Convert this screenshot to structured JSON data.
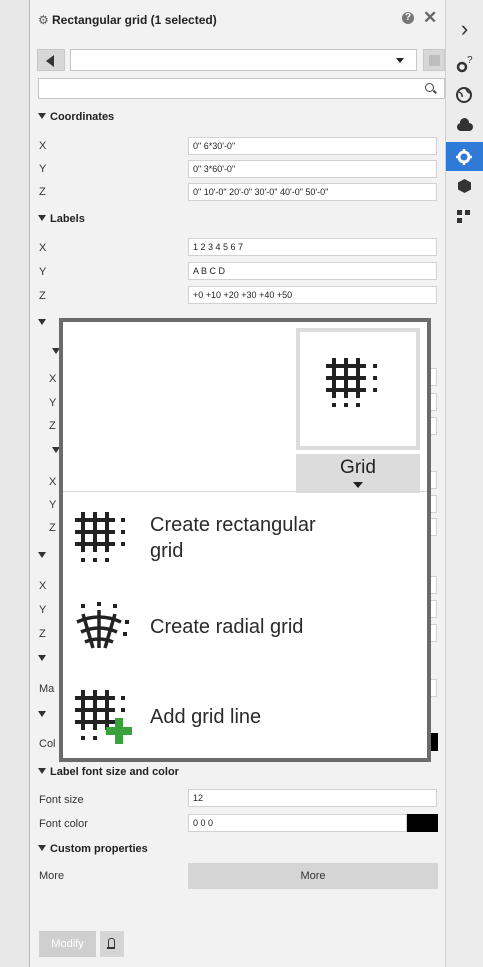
{
  "panel": {
    "title": "Rectangular grid (1 selected)",
    "help_glyph": "?",
    "close_glyph": "✕",
    "search_placeholder": ""
  },
  "coordinates": {
    "header": "Coordinates",
    "rows": [
      {
        "label": "X",
        "value": "0\" 6*30'-0\""
      },
      {
        "label": "Y",
        "value": "0\" 3*60'-0\""
      },
      {
        "label": "Z",
        "value": "0\" 10'-0\" 20'-0\" 30'-0\" 40'-0\" 50'-0\""
      }
    ]
  },
  "labels": {
    "header": "Labels",
    "rows": [
      {
        "label": "X",
        "value": "1 2 3 4 5 6 7"
      },
      {
        "label": "Y",
        "value": "A B C D"
      },
      {
        "label": "Z",
        "value": "+0 +10 +20 +30 +40 +50"
      }
    ]
  },
  "hidden_rows": {
    "xyz_a": [
      "X",
      "Y",
      "Z"
    ],
    "xyz_b": [
      "X",
      "Y",
      "Z"
    ],
    "xyz_c": [
      "X",
      "Y",
      "Z"
    ],
    "mag": "Ma",
    "col": "Col"
  },
  "label_font": {
    "header": "Label font size and color",
    "font_size_label": "Font size",
    "font_size_value": "12",
    "font_color_label": "Font color",
    "font_color_value": "0 0 0",
    "swatch_color": "#000000"
  },
  "custom": {
    "header": "Custom properties",
    "more_label": "More",
    "more_button": "More"
  },
  "footer": {
    "modify_button": "Modify"
  },
  "sidebar": {
    "collapse_glyph": "›",
    "active_color": "#2e7ad6"
  },
  "popup": {
    "grid_label": "Grid",
    "items": [
      {
        "label_line1": "Create rectangular",
        "label_line2": "grid"
      },
      {
        "label_line1": "Create radial grid"
      },
      {
        "label_line1": "Add grid line"
      }
    ],
    "accent_plus_color": "#3aa23a"
  }
}
